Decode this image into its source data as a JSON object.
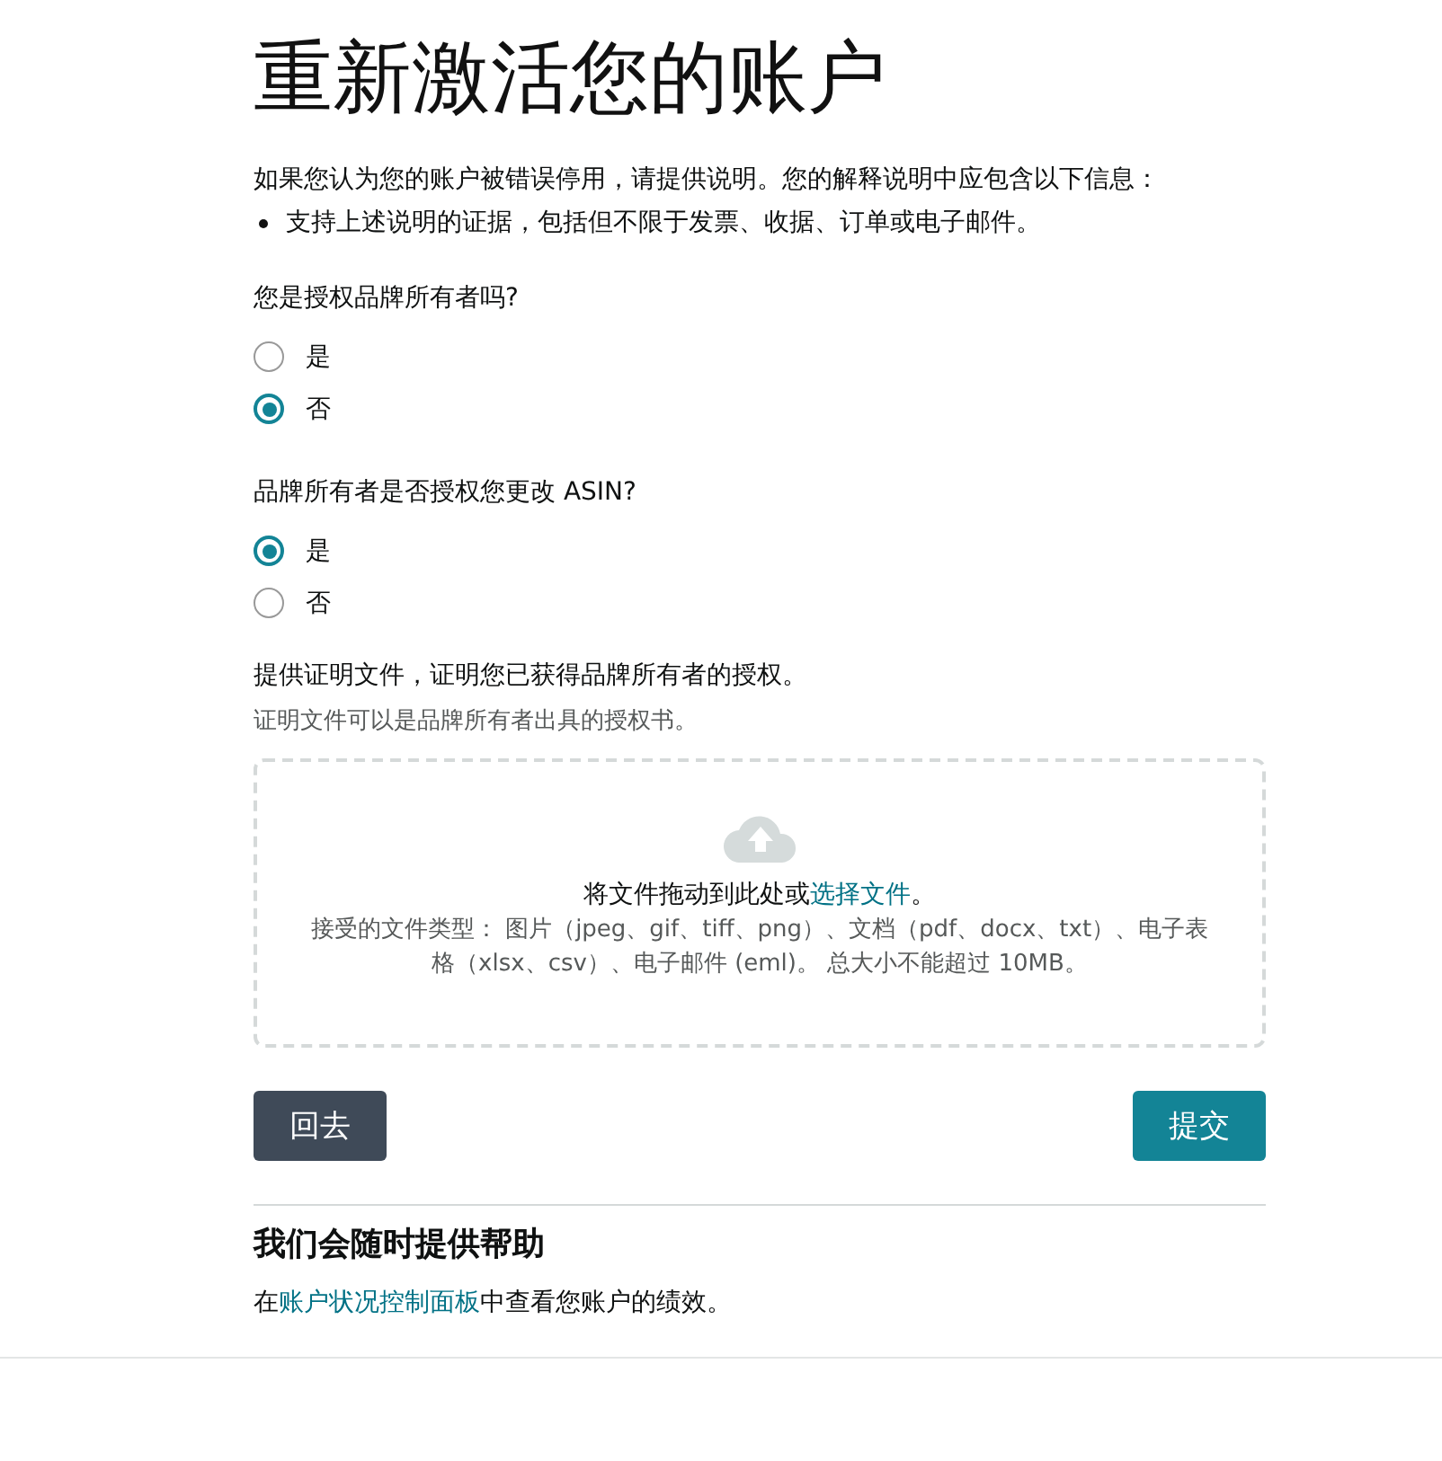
{
  "title": "重新激活您的账户",
  "intro": "如果您认为您的账户被错误停用，请提供说明。您的解释说明中应包含以下信息：",
  "bullets": [
    "支持上述说明的证据，包括但不限于发票、收据、订单或电子邮件。"
  ],
  "questions": [
    {
      "label": "您是授权品牌所有者吗?",
      "options": [
        {
          "label": "是",
          "selected": false
        },
        {
          "label": "否",
          "selected": true
        }
      ]
    },
    {
      "label": "品牌所有者是否授权您更改 ASIN?",
      "options": [
        {
          "label": "是",
          "selected": true
        },
        {
          "label": "否",
          "selected": false
        }
      ]
    }
  ],
  "upload": {
    "label": "提供证明文件，证明您已获得品牌所有者的授权。",
    "hint": "证明文件可以是品牌所有者出具的授权书。",
    "drop_text": {
      "before": "将文件拖动到此处或",
      "link": "选择文件",
      "after": "。"
    },
    "accepted": "接受的文件类型： 图片（jpeg、gif、tiff、png）、文档（pdf、docx、txt）、电子表格（xlsx、csv）、电子邮件 (eml)。 总大小不能超过 10MB。"
  },
  "buttons": {
    "back": "回去",
    "submit": "提交"
  },
  "help": {
    "title": "我们会随时提供帮助",
    "text": {
      "before": "在",
      "link": "账户状况控制面板",
      "after": "中查看您账户的绩效。"
    }
  }
}
